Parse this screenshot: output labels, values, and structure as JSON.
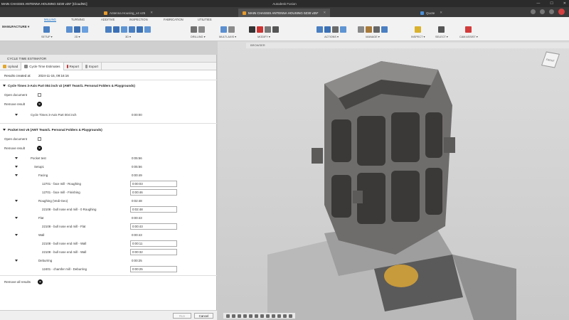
{
  "window": {
    "title": "MAIN CHASSIS ANTENNA HOUSING 0Z30 v25* [CloudNC]",
    "app_name": "Autodesk Fusion"
  },
  "doc_tabs": [
    {
      "label": "Antenna Housing_v4 v25",
      "active": false
    },
    {
      "label": "MAIN CHASSIS ANTENNA HOUSING 0Z30 v25*",
      "active": true
    },
    {
      "label": "Quote",
      "active": false
    }
  ],
  "ribbon": {
    "workspace": "MANUFACTURE ▾",
    "tabs": [
      "MILLING",
      "TURNING",
      "ADDITIVE",
      "INSPECTION",
      "FABRICATION",
      "UTILITIES"
    ],
    "groups": [
      {
        "label": "SETUP ▾",
        "icons": [
          "setup-icon"
        ]
      },
      {
        "label": "2D ▾",
        "icons": [
          "2d-pocket-icon",
          "2d-contour-icon",
          "2d-adaptive-icon"
        ]
      },
      {
        "label": "3D ▾",
        "icons": [
          "3d-adaptive-icon",
          "3d-pocket-icon",
          "3d-steep-icon",
          "3d-parallel-icon",
          "3d-scallop-icon",
          "3d-contour-icon"
        ]
      },
      {
        "label": "DRILLING ▾",
        "icons": [
          "drill-icon",
          "bore-icon"
        ]
      },
      {
        "label": "MULTI-AXIS ▾",
        "icons": [
          "multiaxis-icon",
          "swarf-icon"
        ]
      },
      {
        "label": "MODIFY ▾",
        "icons": [
          "scissors-icon",
          "trim-icon",
          "extend-icon",
          "edit-icon"
        ]
      },
      {
        "label": "ACTIONS ▾",
        "icons": [
          "simulate-icon",
          "post-icon",
          "setup-sheet-icon",
          "nc-program-icon"
        ]
      },
      {
        "label": "MANAGE ▾",
        "icons": [
          "tool-library-icon",
          "template-icon",
          "machine-icon",
          "post-library-icon"
        ]
      },
      {
        "label": "INSPECT ▾",
        "icons": [
          "measure-icon"
        ]
      },
      {
        "label": "SELECT ▾",
        "icons": [
          "select-icon"
        ]
      },
      {
        "label": "CAM ASSIST ▾",
        "icons": [
          "cam-assist-icon"
        ]
      }
    ]
  },
  "panel": {
    "title": "CYCLE TIME ESTIMATOR",
    "tabs": [
      {
        "label": "Upload",
        "active": false
      },
      {
        "label": "Cycle Time Estimates",
        "active": true
      },
      {
        "label": "Report",
        "active": false
      },
      {
        "label": "Export",
        "active": false
      }
    ],
    "results_created_label": "Results created at:",
    "results_created_value": "2024-11-15, 09:16:16",
    "sections": [
      {
        "title": "Cycle Times 3-Axis Part 004 inch v2 (AMT Team/1. Personal Folders & Playgrounds)",
        "open_label": "Open document",
        "remove_label": "Remove result",
        "rows": [
          {
            "name": "Cycle Times 3-Axis Part 004 inch",
            "time": "0:00:00"
          }
        ]
      },
      {
        "title": "Pocket test v5 (AMT Team/1. Personal Folders & Playgrounds)",
        "open_label": "Open document",
        "remove_label": "Remove result",
        "rows": [
          {
            "name": "Pocket test",
            "time": "0:05:56"
          },
          {
            "name": "Setup1",
            "time": "0:05:56"
          },
          {
            "name": "Facing",
            "time": "0:00:49"
          },
          {
            "name": "12701 - face mill - Roughing",
            "time": "0:00:03"
          },
          {
            "name": "12701 - face mill - Finishing",
            "time": "0:00:46"
          },
          {
            "name": "Roughing (Vedi-Geo)",
            "time": "0:02:48"
          },
          {
            "name": "22108 - bull nose end mill - 0 Roughing",
            "time": "0:02:48"
          },
          {
            "name": "Flat",
            "time": "0:00:43"
          },
          {
            "name": "22108 - bull nose end mill - Flat",
            "time": "0:00:43"
          },
          {
            "name": "Wall",
            "time": "0:00:43"
          },
          {
            "name": "22108 - bull nose end mill - Wall",
            "time": "0:00:11"
          },
          {
            "name": "22108 - bull nose end mill - Wall",
            "time": "0:00:32"
          },
          {
            "name": "Deburring",
            "time": "0:00:25"
          },
          {
            "name": "12401 - chamfer mill - Deburring",
            "time": "0:00:25"
          }
        ]
      }
    ],
    "remove_all_label": "Remove all results",
    "footer": {
      "ok": "Run",
      "cancel": "Cancel"
    }
  },
  "viewport": {
    "browser_label": "BROWSER",
    "viewcube_label": "FRONT"
  },
  "colors": {
    "accent": "#1a6fc2",
    "titlebar": "#2b2b2b",
    "tabbar": "#3a3a3a",
    "part": "#7a7877"
  }
}
